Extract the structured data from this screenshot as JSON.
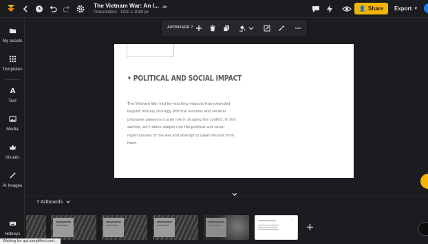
{
  "header": {
    "doc_title": "The Vietnam War: An I...",
    "doc_subtitle": "Presentation · 1920 x 1080 px",
    "share_label": "Share",
    "export_label": "Export"
  },
  "sidebar": {
    "items": [
      {
        "label": "My assets",
        "icon": "folder-icon"
      },
      {
        "label": "Templates",
        "icon": "grid-icon"
      },
      {
        "label": "Text",
        "icon": "text-icon"
      },
      {
        "label": "Media",
        "icon": "image-icon"
      },
      {
        "label": "Visuals",
        "icon": "crown-icon"
      },
      {
        "label": "AI Images",
        "icon": "magic-wand-icon"
      },
      {
        "label": "Hotkeys",
        "icon": "keyboard-icon"
      }
    ]
  },
  "toolbar": {
    "artboard_name": "ARTBOARD 7"
  },
  "slide": {
    "heading": "• POLITICAL AND SOCIAL IMPACT",
    "body": "The Vietnam War had far-reaching impacts that extended beyond military strategy. Political tensions and societal pressures played a crucial role in shaping the conflict. In this section, we'll delve deeper into the political and social repercussions of the war and attempt to glean lessons from them."
  },
  "filmstrip": {
    "count_label": "7 Artboards"
  },
  "status": {
    "text": "Waiting for api.simplified.com..."
  },
  "colors": {
    "accent": "#f5b400",
    "background": "#1b1c1f",
    "brand_blue": "#1d7bf5"
  }
}
